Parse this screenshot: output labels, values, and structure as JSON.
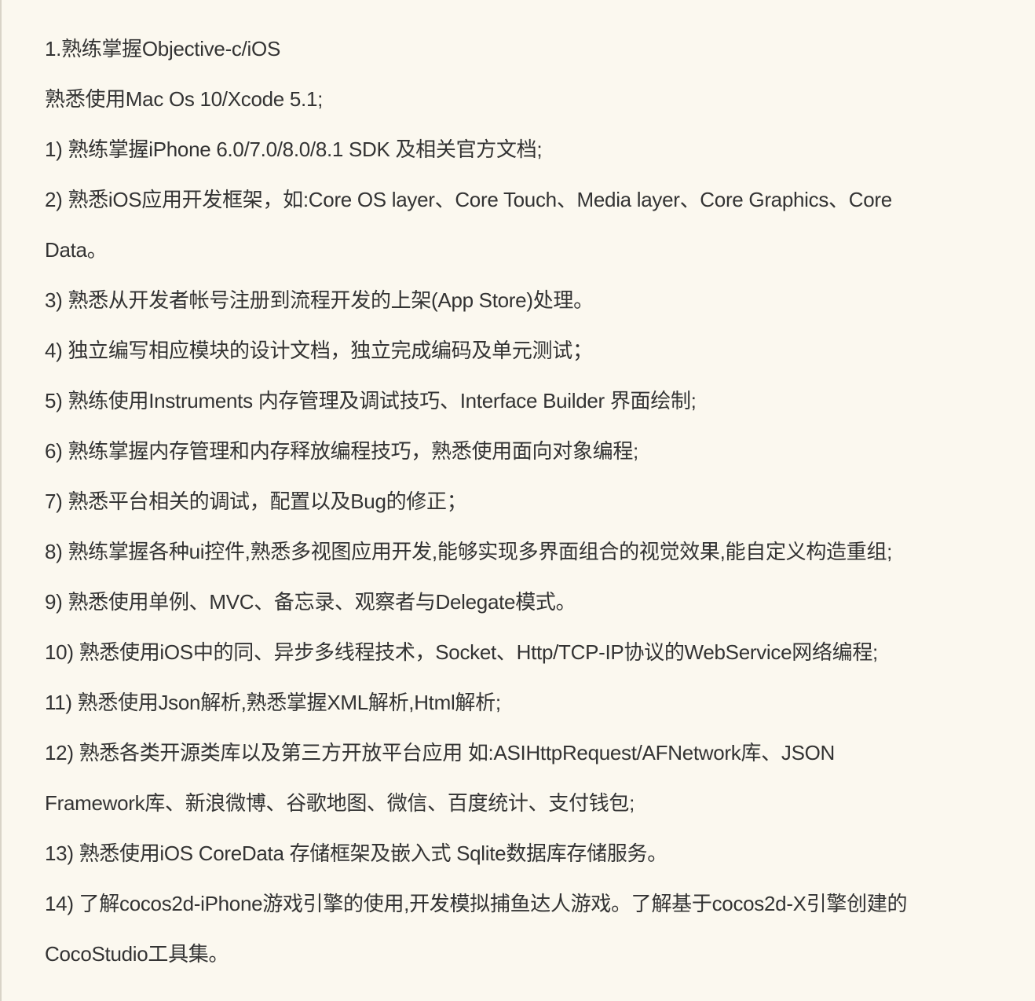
{
  "document": {
    "lines": [
      "1.熟练掌握Objective-c/iOS",
      "熟悉使用Mac Os 10/Xcode 5.1;",
      "1) 熟练掌握iPhone 6.0/7.0/8.0/8.1 SDK 及相关官方文档;",
      "2)  熟悉iOS应用开发框架，如:Core OS layer、Core Touch、Media layer、Core Graphics、Core",
      "Data。",
      "3)  熟悉从开发者帐号注册到流程开发的上架(App Store)处理。",
      "4)  独立编写相应模块的设计文档，独立完成编码及单元测试；",
      "5)  熟练使用Instruments 内存管理及调试技巧、Interface Builder 界面绘制;",
      "6)  熟练掌握内存管理和内存释放编程技巧，熟悉使用面向对象编程;",
      "7)  熟悉平台相关的调试，配置以及Bug的修正；",
      "8)  熟练掌握各种ui控件,熟悉多视图应用开发,能够实现多界面组合的视觉效果,能自定义构造重组;",
      "9)  熟悉使用单例、MVC、备忘录、观察者与Delegate模式。",
      "10) 熟悉使用iOS中的同、异步多线程技术，Socket、Http/TCP-IP协议的WebService网络编程;",
      "11) 熟悉使用Json解析,熟悉掌握XML解析,Html解析;",
      "12) 熟悉各类开源类库以及第三方开放平台应用 如:ASIHttpRequest/AFNetwork库、JSON",
      "Framework库、新浪微博、谷歌地图、微信、百度统计、支付钱包;",
      "13) 熟悉使用iOS CoreData 存储框架及嵌入式 Sqlite数据库存储服务。",
      "14) 了解cocos2d-iPhone游戏引擎的使用,开发模拟捕鱼达人游戏。了解基于cocos2d-X引擎创建的",
      "CocoStudio工具集。"
    ]
  }
}
